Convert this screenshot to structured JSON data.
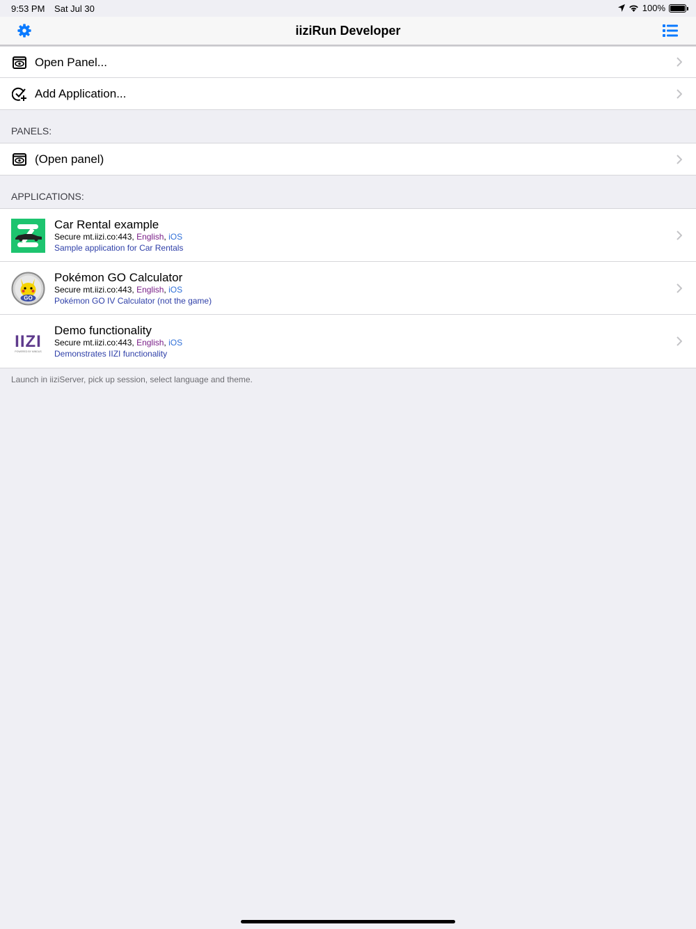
{
  "status": {
    "time": "9:53 PM",
    "date": "Sat Jul 30",
    "battery": "100%"
  },
  "nav": {
    "title": "iiziRun Developer",
    "left_icon": "gear-icon",
    "right_icon": "list-icon",
    "accent": "#0a7aff"
  },
  "actions": [
    {
      "label": "Open Panel...",
      "icon": "panel-eye-icon"
    },
    {
      "label": "Add Application...",
      "icon": "add-check-icon"
    }
  ],
  "panels": {
    "header": "PANELS:",
    "items": [
      {
        "label": "(Open panel)",
        "icon": "panel-eye-icon"
      }
    ]
  },
  "applications": {
    "header": "APPLICATIONS:",
    "items": [
      {
        "title": "Car Rental example",
        "server": "Secure mt.iizi.co:443, ",
        "language": "English",
        "sep": ", ",
        "os": "iOS",
        "description": "Sample application for Car Rentals",
        "icon": "car-rental-logo"
      },
      {
        "title": "Pokémon GO Calculator",
        "server": "Secure mt.iizi.co:443, ",
        "language": "English",
        "sep": ", ",
        "os": "iOS",
        "description": "Pokémon GO IV Calculator (not the game)",
        "icon": "pokemon-go-logo"
      },
      {
        "title": "Demo functionality",
        "server": "Secure mt.iizi.co:443, ",
        "language": "English",
        "sep": ", ",
        "os": "iOS",
        "description": "Demonstrates IIZI functionality",
        "icon": "iizi-logo",
        "logo_text": "IIZI",
        "logo_subtext": "POWERED BY MINDUS"
      }
    ]
  },
  "footer": "Launch in iiziServer, pick up session, select language and theme."
}
